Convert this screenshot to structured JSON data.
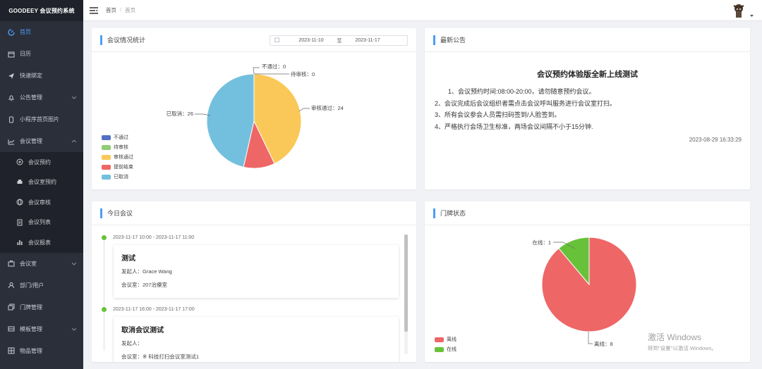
{
  "app": {
    "title": "GOODEEY 会议预约系统"
  },
  "sidebar": {
    "items": [
      {
        "label": "首页",
        "icon": "dashboard-icon",
        "active": true
      },
      {
        "label": "日历",
        "icon": "calendar-icon"
      },
      {
        "label": "快速绑定",
        "icon": "send-icon"
      },
      {
        "label": "公告管理",
        "icon": "bell-icon",
        "chevron": "down"
      },
      {
        "label": "小程序首页图片",
        "icon": "mobile-icon"
      },
      {
        "label": "会议管理",
        "icon": "chart-line-icon",
        "chevron": "up"
      }
    ],
    "sub_items": [
      {
        "label": "会议预约",
        "icon": "plus-circle-icon"
      },
      {
        "label": "会议室预约",
        "icon": "printer-icon"
      },
      {
        "label": "会议审核",
        "icon": "globe-icon"
      },
      {
        "label": "会议列表",
        "icon": "document-icon"
      },
      {
        "label": "会议报表",
        "icon": "bar-chart-icon"
      }
    ],
    "items_after": [
      {
        "label": "会议室",
        "icon": "briefcase-icon",
        "chevron": "down"
      },
      {
        "label": "部门/用户",
        "icon": "user-icon"
      },
      {
        "label": "门牌管理",
        "icon": "copy-icon"
      },
      {
        "label": "模板管理",
        "icon": "layers-icon",
        "chevron": "down"
      },
      {
        "label": "物品管理",
        "icon": "grid-icon"
      }
    ]
  },
  "header": {
    "breadcrumb": [
      "首页",
      "首页"
    ],
    "separator": "/"
  },
  "stats_card": {
    "title": "会议情况统计",
    "date_from": "2023-11-10",
    "date_to_label": "至",
    "date_to": "2023-11-17"
  },
  "chart_data": [
    {
      "type": "pie",
      "series": [
        {
          "name": "不通过",
          "value": 0,
          "color": "#5470c6"
        },
        {
          "name": "待审核",
          "value": 0,
          "color": "#91cc75"
        },
        {
          "name": "审核通过",
          "value": 24,
          "color": "#fac858"
        },
        {
          "name": "提前结束",
          "value": 6,
          "color": "#ee6666"
        },
        {
          "name": "已取消",
          "value": 26,
          "color": "#73c0de"
        }
      ],
      "labels": [
        "不通过：0",
        "待审核：0",
        "审核通过：24",
        "提前结束：6",
        "已取消：26"
      ],
      "legend": "bottom-left"
    },
    {
      "type": "pie",
      "series": [
        {
          "name": "离线",
          "value": 8,
          "color": "#ee6666"
        },
        {
          "name": "在线",
          "value": 1,
          "color": "#67c23a"
        }
      ],
      "labels": [
        "离线：8",
        "在线：1"
      ],
      "legend": "bottom-left"
    }
  ],
  "announce_card": {
    "title": "最新公告",
    "heading": "会议预约体验版全新上线测试",
    "lines": [
      "1、会议预约时间:08:00-20:00，请勿随意预约会议。",
      "2、会议完成后会议组织者需点击会议呼叫服务进行会议室打扫。",
      "3、所有会议参会人员需扫码签到/人脸签到。",
      "4、严格执行会场卫生标准，两场会议间隔不小于15分钟."
    ],
    "date": "2023-08-29 16:33:29"
  },
  "today_card": {
    "title": "今日会议",
    "meetings": [
      {
        "time": "2023-11-17 10:00 - 2023-11-17 11:00",
        "name": "测试",
        "initiator": "发起人：Grace Wang",
        "room": "会议室：207治療室"
      },
      {
        "time": "2023-11-17 16:00 - 2023-11-17 17:00",
        "name": "取消会议测试",
        "initiator": "发起人：",
        "room": "会议室：※ 科技打扫会议室测试1"
      }
    ]
  },
  "door_card": {
    "title": "门牌状态"
  },
  "watermark": {
    "line1": "激活 Windows",
    "line2": "转到\"设置\"以激活 Windows。"
  }
}
